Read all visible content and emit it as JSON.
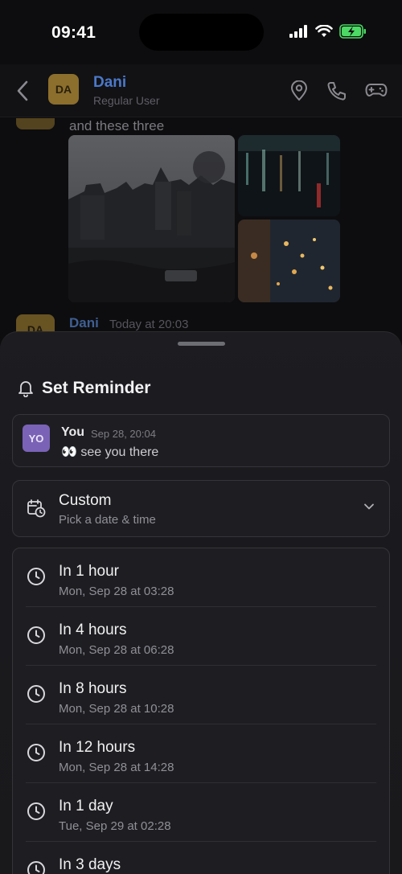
{
  "status_bar": {
    "time": "09:41"
  },
  "chat_header": {
    "avatar_initials": "DA",
    "name": "Dani",
    "subtitle": "Regular User",
    "icons": [
      "location-pin-icon",
      "phone-icon",
      "gamepad-icon"
    ]
  },
  "messages": {
    "partial_text": "and these three",
    "second_message": {
      "avatar_initials": "DA",
      "name": "Dani",
      "time": "Today at 20:03"
    }
  },
  "sheet": {
    "title": "Set Reminder",
    "quoted_message": {
      "avatar_initials": "YO",
      "author": "You",
      "time": "Sep 28, 20:04",
      "text": "👀 see you there"
    },
    "custom": {
      "label": "Custom",
      "sublabel": "Pick a date & time"
    },
    "options": [
      {
        "label": "In 1 hour",
        "sublabel": "Mon, Sep 28 at 03:28"
      },
      {
        "label": "In 4 hours",
        "sublabel": "Mon, Sep 28 at 06:28"
      },
      {
        "label": "In 8 hours",
        "sublabel": "Mon, Sep 28 at 10:28"
      },
      {
        "label": "In 12 hours",
        "sublabel": "Mon, Sep 28 at 14:28"
      },
      {
        "label": "In 1 day",
        "sublabel": "Tue, Sep 29 at 02:28"
      },
      {
        "label": "In 3 days",
        "sublabel": ""
      }
    ]
  },
  "colors": {
    "accent_name": "#4b78c9",
    "avatar_dani": "#d7a83d",
    "avatar_you": "#7a63b6",
    "battery_green": "#4cd964"
  }
}
